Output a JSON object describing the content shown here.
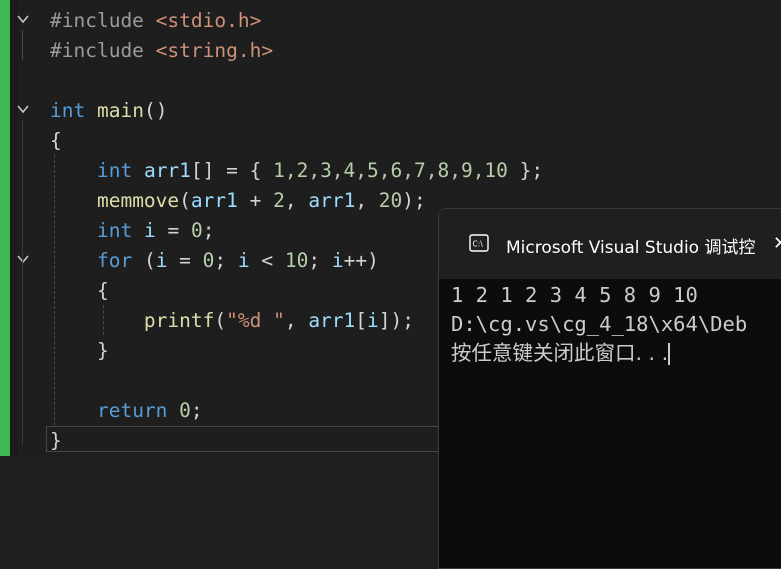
{
  "editor": {
    "lines": [
      {
        "segments": [
          {
            "t": "#include ",
            "c": "pp"
          },
          {
            "t": "<stdio.h>",
            "c": "inc"
          }
        ]
      },
      {
        "segments": [
          {
            "t": "#include ",
            "c": "pp"
          },
          {
            "t": "<string.h>",
            "c": "inc"
          }
        ]
      },
      {
        "segments": []
      },
      {
        "segments": [
          {
            "t": "int",
            "c": "kw"
          },
          {
            "t": " "
          },
          {
            "t": "main",
            "c": "fn"
          },
          {
            "t": "()"
          }
        ]
      },
      {
        "segments": [
          {
            "t": "{"
          }
        ]
      },
      {
        "segments": [
          {
            "t": "    "
          },
          {
            "t": "int",
            "c": "kw"
          },
          {
            "t": " "
          },
          {
            "t": "arr1",
            "c": "var"
          },
          {
            "t": "[] = { "
          },
          {
            "t": "1,2,3,4,5,6,7,8,9,10",
            "c": "num"
          },
          {
            "t": " };"
          }
        ]
      },
      {
        "segments": [
          {
            "t": "    "
          },
          {
            "t": "memmove",
            "c": "fn"
          },
          {
            "t": "("
          },
          {
            "t": "arr1",
            "c": "var"
          },
          {
            "t": " + "
          },
          {
            "t": "2",
            "c": "num"
          },
          {
            "t": ", "
          },
          {
            "t": "arr1",
            "c": "var"
          },
          {
            "t": ", "
          },
          {
            "t": "20",
            "c": "num"
          },
          {
            "t": ");"
          }
        ]
      },
      {
        "segments": [
          {
            "t": "    "
          },
          {
            "t": "int",
            "c": "kw"
          },
          {
            "t": " "
          },
          {
            "t": "i",
            "c": "var"
          },
          {
            "t": " = "
          },
          {
            "t": "0",
            "c": "num"
          },
          {
            "t": ";"
          }
        ]
      },
      {
        "segments": [
          {
            "t": "    "
          },
          {
            "t": "for",
            "c": "kw"
          },
          {
            "t": " ("
          },
          {
            "t": "i",
            "c": "var"
          },
          {
            "t": " = "
          },
          {
            "t": "0",
            "c": "num"
          },
          {
            "t": "; "
          },
          {
            "t": "i",
            "c": "var"
          },
          {
            "t": " < "
          },
          {
            "t": "10",
            "c": "num"
          },
          {
            "t": "; "
          },
          {
            "t": "i",
            "c": "var"
          },
          {
            "t": "++)"
          }
        ]
      },
      {
        "segments": [
          {
            "t": "    {"
          }
        ]
      },
      {
        "segments": [
          {
            "t": "        "
          },
          {
            "t": "printf",
            "c": "fn"
          },
          {
            "t": "("
          },
          {
            "t": "\"%d \"",
            "c": "str"
          },
          {
            "t": ", "
          },
          {
            "t": "arr1",
            "c": "var"
          },
          {
            "t": "["
          },
          {
            "t": "i",
            "c": "var"
          },
          {
            "t": "]);"
          }
        ]
      },
      {
        "segments": [
          {
            "t": "    }"
          }
        ]
      },
      {
        "segments": []
      },
      {
        "segments": [
          {
            "t": "    "
          },
          {
            "t": "return",
            "c": "kw"
          },
          {
            "t": " "
          },
          {
            "t": "0",
            "c": "num"
          },
          {
            "t": ";"
          }
        ]
      },
      {
        "segments": [
          {
            "t": "}"
          }
        ]
      }
    ],
    "colors": {
      "keyword": "#569cd6",
      "function": "#dcdcaa",
      "variable": "#9cdcfe",
      "number": "#b5cea8",
      "string": "#ce9178",
      "change_bar": "#3fb950"
    }
  },
  "console": {
    "title": "Microsoft Visual Studio 调试控",
    "close_glyph": "✕",
    "output": [
      "1 2 1 2 3 4 5 8 9 10",
      "D:\\cg.vs\\cg_4_18\\x64\\Deb",
      "按任意键关闭此窗口. . ."
    ]
  }
}
